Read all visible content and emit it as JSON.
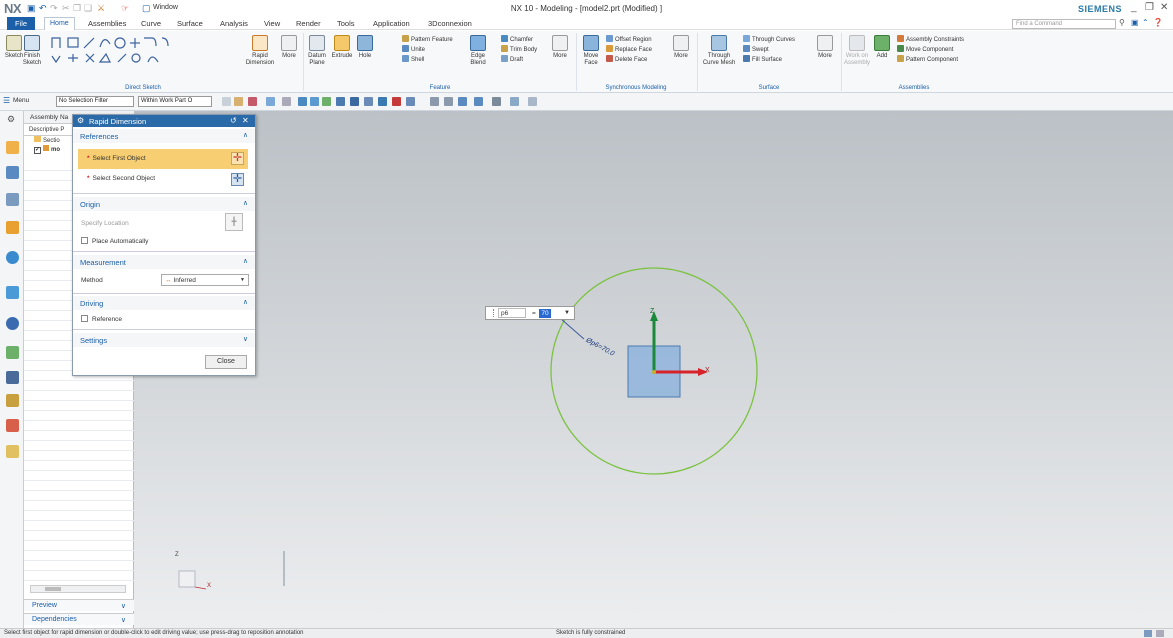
{
  "app": {
    "logo": "NX",
    "window_menu": "Window",
    "title": "NX 10 - Modeling - [model2.prt (Modified) ]",
    "brand": "SIEMENS"
  },
  "menu": {
    "tabs": [
      "File",
      "Home",
      "Assemblies",
      "Curve",
      "Surface",
      "Analysis",
      "View",
      "Render",
      "Tools",
      "Application",
      "3Dconnexion"
    ],
    "find_placeholder": "Find a Command"
  },
  "ribbon": {
    "sketch": "Sketch",
    "finish_sketch": "Finish Sketch",
    "direct_sketch_group": "Direct Sketch",
    "rapid_dimension": "Rapid Dimension",
    "more": "More",
    "datum_plane": "Datum Plane",
    "extrude": "Extrude",
    "hole": "Hole",
    "pattern_feature": "Pattern Feature",
    "unite": "Unite",
    "shell": "Shell",
    "edge_blend": "Edge Blend",
    "chamfer": "Chamfer",
    "trim_body": "Trim Body",
    "draft": "Draft",
    "feature_group": "Feature",
    "move_face": "Move Face",
    "offset_region": "Offset Region",
    "replace_face": "Replace Face",
    "delete_face": "Delete Face",
    "sync_group": "Synchronous Modeling",
    "through_curve_mesh": "Through Curve Mesh",
    "through_curves": "Through Curves",
    "swept": "Swept",
    "fill_surface": "Fill Surface",
    "surface_group": "Surface",
    "work_on_assembly": "Work on Assembly",
    "add": "Add",
    "assembly_constraints": "Assembly Constraints",
    "move_component": "Move Component",
    "pattern_component": "Pattern Component",
    "assemblies_group": "Assemblies"
  },
  "selbar": {
    "menu": "Menu",
    "filter": "No Selection Filter",
    "scope": "Within Work Part O"
  },
  "nav": {
    "title": "Assembly Na",
    "column": "Descriptive P",
    "section": "Sectio",
    "model": "mo",
    "preview": "Preview",
    "dependencies": "Dependencies"
  },
  "dialog": {
    "title": "Rapid Dimension",
    "references": "References",
    "select_first": "Select First Object",
    "select_second": "Select Second Object",
    "origin": "Origin",
    "specify_location": "Specify Location",
    "place_auto": "Place Automatically",
    "measurement": "Measurement",
    "method_label": "Method",
    "method_value": "Inferred",
    "driving": "Driving",
    "reference": "Reference",
    "settings": "Settings",
    "close": "Close"
  },
  "onscreen": {
    "param": "p6",
    "equals": "=",
    "value": "70",
    "dim_label": "Øp6=70.0"
  },
  "triad": {
    "x": "X",
    "z": "Z"
  },
  "status": {
    "left": "Select first object for rapid dimension or double-click to edit driving value; use press-drag to reposition annotation",
    "center": "Sketch is fully constrained"
  },
  "colors": {
    "accent": "#1a5fa8",
    "dialog_highlight": "#f7ce72",
    "circle": "#7cc242",
    "square_fill": "#8fb4dc",
    "x_axis": "#d6232a",
    "z_axis": "#1a8a3a"
  }
}
